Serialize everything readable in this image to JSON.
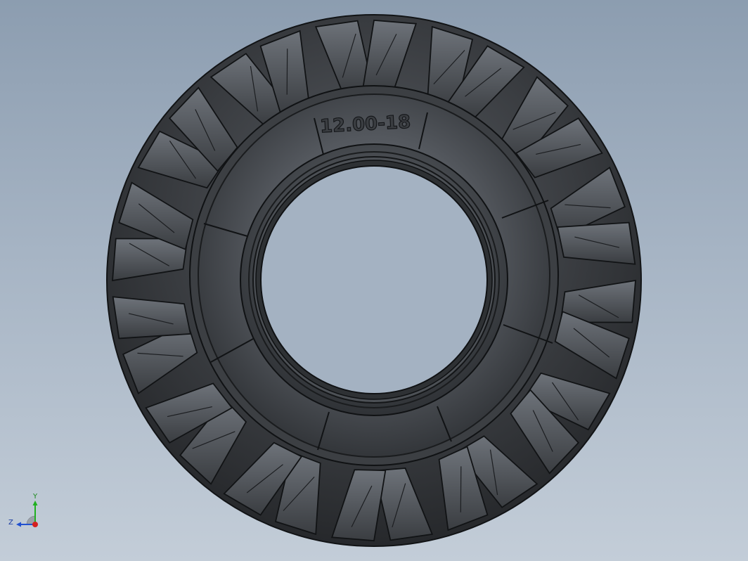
{
  "model": {
    "sidewall_marking": "12.00-18",
    "tread_block_count": 28
  },
  "axis_triad": {
    "x_label": "",
    "y_label": "Y",
    "z_label": "Z"
  },
  "colors": {
    "background_top": "#8c9db0",
    "background_bottom": "#c3cdd8",
    "rubber_dark": "#2a2d30",
    "rubber_mid": "#4a4e53",
    "rubber_light": "#6b7077",
    "edge": "#111315",
    "axis_x": "#d42020",
    "axis_y": "#20b020",
    "axis_z": "#2050d0"
  }
}
